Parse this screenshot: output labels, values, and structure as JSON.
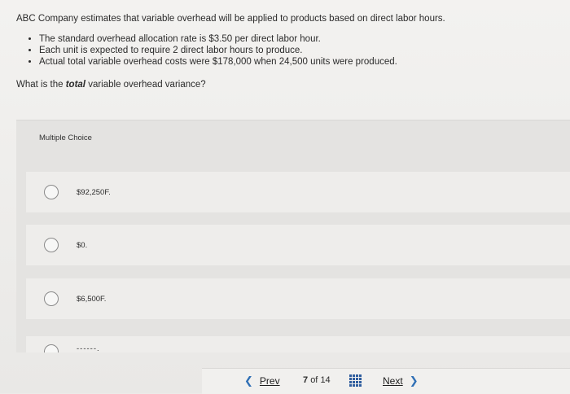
{
  "question": {
    "intro": "ABC Company estimates that variable overhead will be applied to products based on direct labor hours.",
    "bullets": [
      "The standard overhead allocation rate is $3.50 per direct labor hour.",
      "Each unit is expected to require 2 direct labor hours to produce.",
      "Actual total variable overhead costs were $178,000 when 24,500 units were produced."
    ],
    "prompt_before": "What is the ",
    "prompt_emphasis": "total",
    "prompt_after": " variable overhead variance?"
  },
  "multiple_choice": {
    "label": "Multiple Choice",
    "options": [
      {
        "text": "$92,250F."
      },
      {
        "text": "$0."
      },
      {
        "text": "$6,500F."
      },
      {
        "text": "------."
      }
    ]
  },
  "nav": {
    "prev_label": "Prev",
    "next_label": "Next",
    "current_page": "7",
    "page_sep": "of",
    "total_pages": "14",
    "prev_icon": "chevron-left-icon",
    "next_icon": "chevron-right-icon",
    "grid_icon": "grid-icon",
    "accent_color": "#2f6fb5"
  }
}
